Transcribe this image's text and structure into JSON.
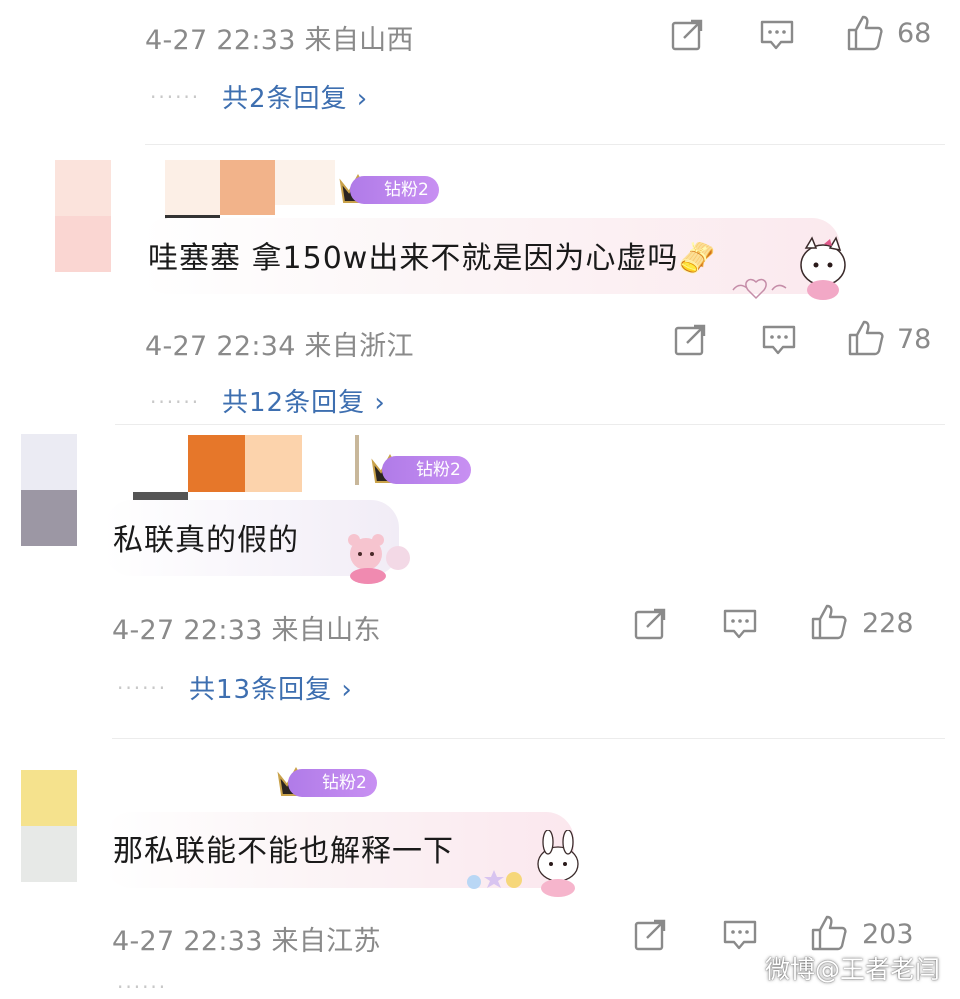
{
  "comments": [
    {
      "meta": "4-27 22:33 来自山西",
      "likes": "68",
      "replies": "共2条回复 ›"
    },
    {
      "badge": "钻粉2",
      "text": "哇塞塞 拿150w出来不就是因为心虚吗🫔",
      "meta": "4-27 22:34 来自浙江",
      "likes": "78",
      "replies": "共12条回复 ›"
    },
    {
      "badge": "钻粉2",
      "text": "私联真的假的",
      "meta": "4-27 22:33 来自山东",
      "likes": "228",
      "replies": "共13条回复 ›"
    },
    {
      "badge": "钻粉2",
      "text": "那私联能不能也解释一下",
      "meta": "4-27 22:33 来自江苏",
      "likes": "203"
    }
  ],
  "dots": "······",
  "watermark": "微博@王者老闫",
  "icons": {
    "share": "share-icon",
    "comment": "comment-icon",
    "like": "thumbs-up-icon",
    "crown": "crown-icon",
    "chevron": "chevron-right-icon"
  },
  "colors": {
    "meta_text": "#8a8a8a",
    "reply_link": "#3e6fb0",
    "badge_bg": "#b07be8"
  }
}
